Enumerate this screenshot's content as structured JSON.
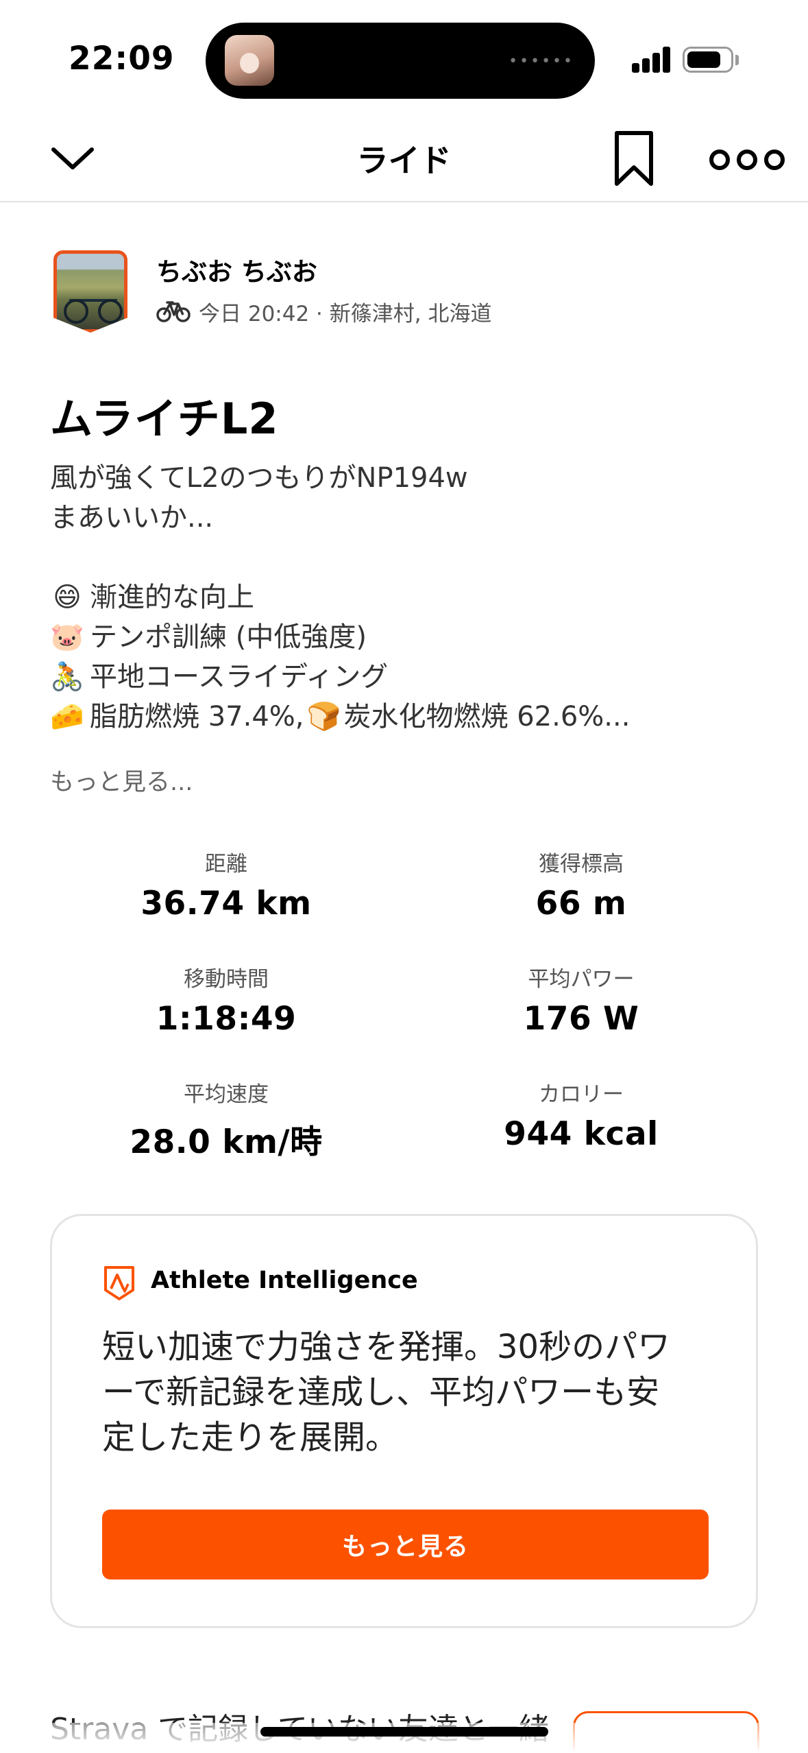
{
  "status_bar": {
    "time": "22:09",
    "island_dots": "••••••"
  },
  "nav": {
    "title": "ライド",
    "back_icon": "chevron-down-icon",
    "bookmark_icon": "bookmark-icon",
    "more_icon": "more-icon"
  },
  "athlete": {
    "name": "ちぶお ちぶお",
    "activity_icon": "bike-icon",
    "meta": "今日 20:42 · 新篠津村, 北海道"
  },
  "activity": {
    "title": "ムライチL2",
    "description_lines": [
      "風が強くてL2のつもりがNP194w",
      "まあいいか..."
    ],
    "tags": [
      {
        "emoji": "😄",
        "text": "漸進的な向上"
      },
      {
        "emoji": "🐷",
        "text": "テンポ訓練 (中低強度)"
      },
      {
        "emoji": "🚴",
        "text": "平地コースライディング"
      }
    ],
    "fuel_line": {
      "emoji1": "🧀",
      "text1": "脂肪燃焼 37.4%,",
      "emoji2": "🍞",
      "text2": "炭水化物燃焼 62.6%..."
    },
    "see_more": "もっと見る..."
  },
  "stats": [
    {
      "label": "距離",
      "value": "36.74 km"
    },
    {
      "label": "獲得標高",
      "value": "66 m"
    },
    {
      "label": "移動時間",
      "value": "1:18:49"
    },
    {
      "label": "平均パワー",
      "value": "176 W"
    },
    {
      "label": "平均速度",
      "value": "28.0 km/時"
    },
    {
      "label": "カロリー",
      "value": "944 kcal"
    }
  ],
  "athlete_intelligence": {
    "title": "Athlete Intelligence",
    "body_lines": [
      "短い加速で力強さを発揮。30秒のパワ",
      "ーで新記録を達成し、平均パワーも安",
      "定した走りを展開。"
    ],
    "button_label": "もっと見る"
  },
  "invite": {
    "text": "Strava で記録していない友達と一緒"
  },
  "colors": {
    "accent": "#fc5200",
    "avatar_border": "#e8531b"
  }
}
